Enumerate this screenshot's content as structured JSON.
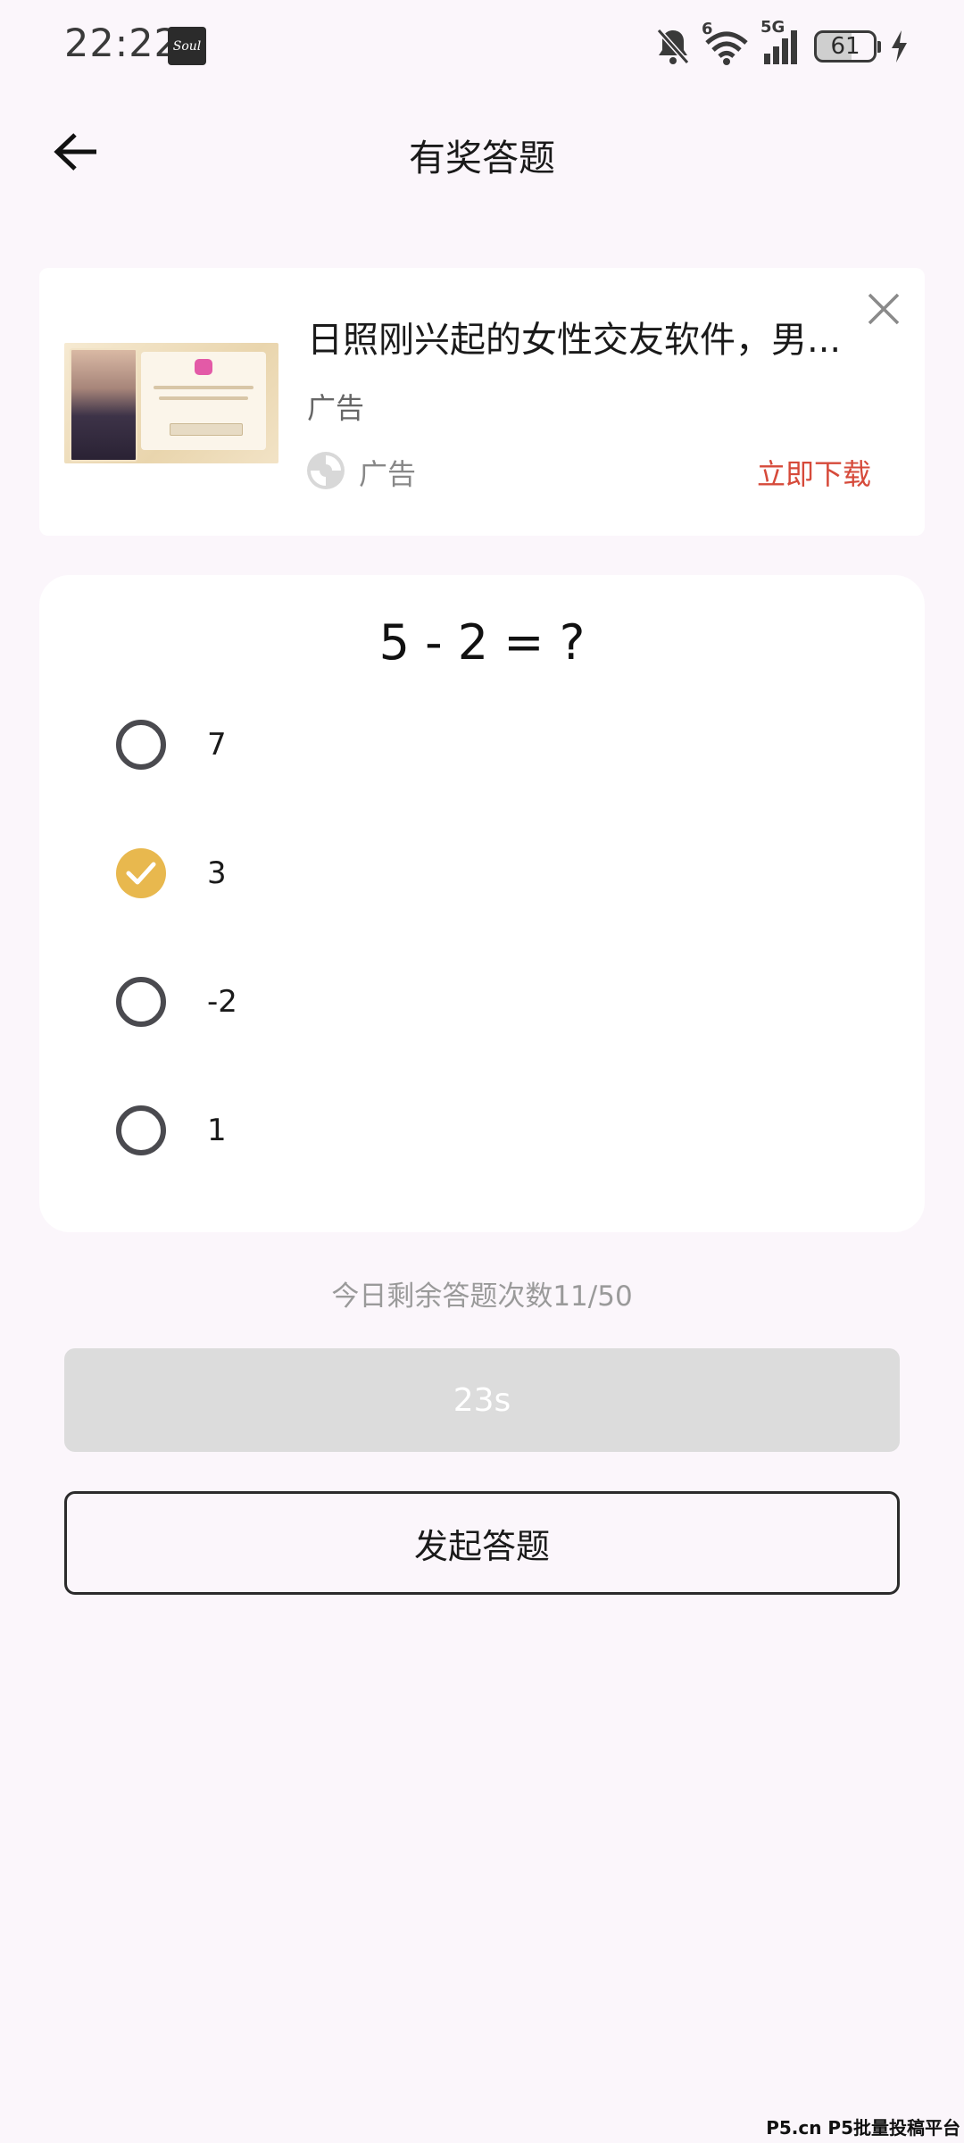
{
  "status_bar": {
    "time": "22:22",
    "app_icon_label": "Soul",
    "battery_level": "61",
    "wifi_badge": "6",
    "network": "5G"
  },
  "header": {
    "title": "有奖答题",
    "back_icon": "arrow-left-icon"
  },
  "ad": {
    "title": "日照刚兴起的女性交友软件，男...",
    "subtitle": "广告",
    "source_label": "广告",
    "cta": "立即下载",
    "close_icon": "close-icon",
    "cta_color": "#d64a3a"
  },
  "question": {
    "text": "5 - 2 = ?",
    "options": [
      {
        "label": "7",
        "selected": false
      },
      {
        "label": "3",
        "selected": true
      },
      {
        "label": "-2",
        "selected": false
      },
      {
        "label": "1",
        "selected": false
      }
    ],
    "accent_color": "#e8b84e"
  },
  "remaining_text": "今日剩余答题次数11/50",
  "timer_label": "23s",
  "start_button_label": "发起答题",
  "watermark": "P5.cn P5批量投稿平台"
}
